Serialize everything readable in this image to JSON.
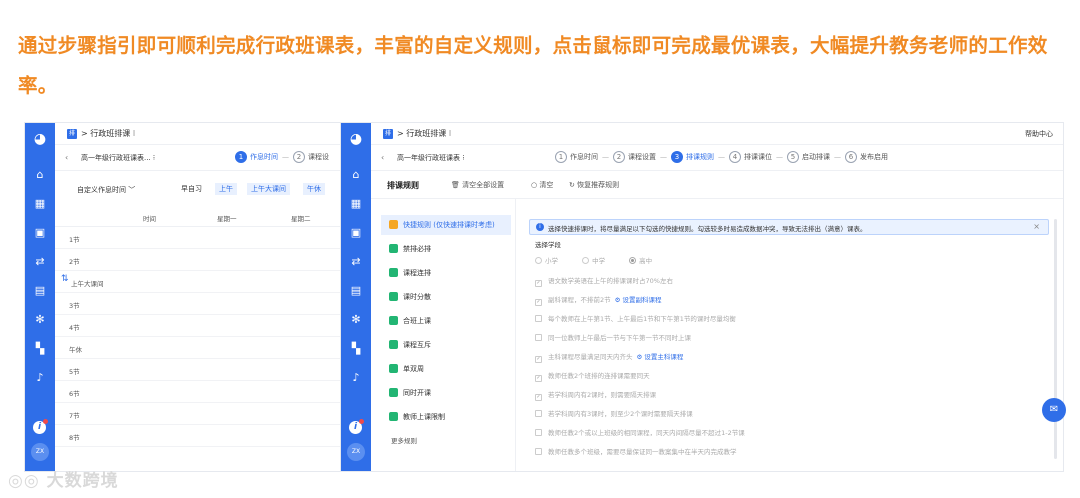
{
  "headline": "通过步骤指引即可顺利完成行政班课表，丰富的自定义规则，点击鼠标即可完成最优课表，大幅提升教务老师的工作效率。",
  "colors": {
    "accent": "#2f6ee8",
    "headline": "#f08a24",
    "rule_icon": "#22b573"
  },
  "sidebar": {
    "icons": [
      "logo-icon",
      "home-icon",
      "schedule-icon",
      "choose-icon",
      "sync-icon",
      "report-icon",
      "settings-icon",
      "apps-icon",
      "bell-icon"
    ],
    "avatar": "ZX",
    "info": "i"
  },
  "left_window": {
    "badge": "排",
    "breadcrumb": "> 行政班排课 ⁝",
    "selector": "高一年级行政班课表...  ⁝",
    "steps": [
      {
        "num": "1",
        "label": "作息时间",
        "active": true
      },
      {
        "num": "2",
        "label": "课程设",
        "active": false
      }
    ],
    "filter_label": "自定义作息时间 ﹀",
    "filters": [
      "早自习",
      "上午",
      "上午大课间",
      "午休"
    ],
    "columns": [
      "时间",
      "星期一",
      "星期二"
    ],
    "rows": [
      "1节",
      "2节",
      "上午大课间",
      "3节",
      "4节",
      "午休",
      "5节",
      "6节",
      "7节",
      "8节"
    ]
  },
  "right_window": {
    "badge": "排",
    "breadcrumb": "> 行政班排课 ⁝",
    "help": "帮助中心",
    "selector": "高一年级行政班课表  ⁝",
    "steps": [
      {
        "num": "1",
        "label": "作息时间",
        "active": false
      },
      {
        "num": "2",
        "label": "课程设置",
        "active": false
      },
      {
        "num": "3",
        "label": "排课规则",
        "active": true
      },
      {
        "num": "4",
        "label": "排课课位",
        "active": false
      },
      {
        "num": "5",
        "label": "启动排课",
        "active": false
      },
      {
        "num": "6",
        "label": "发布启用",
        "active": false
      }
    ],
    "panel_title": "排课规则",
    "clear_all": "清空全部设置",
    "clear": "清空",
    "restore": "恢复推荐规则",
    "rules": [
      "快捷规则 (仅快速排课时考虑)",
      "禁排必排",
      "课程连排",
      "课时分散",
      "合班上课",
      "课程互斥",
      "单双周",
      "同时开课",
      "教师上课限制"
    ],
    "more_rules": "更多规则",
    "notice": "选择快速排课时，将尽量满足以下勾选的快捷规则。勾选较多时易造成数据冲突，导致无法排出（满意）课表。",
    "notice_close": "×",
    "school_label": "选择学段",
    "school_options": [
      "小学",
      "中学",
      "高中"
    ],
    "options": [
      {
        "text": "语文数学英语在上午的排课课时占70%左右",
        "checked": true,
        "link": ""
      },
      {
        "text": "副科课程，不排前2节",
        "checked": true,
        "link": "设置副科课程"
      },
      {
        "text": "每个教师在上午第1节、上午最后1节和下午第1节的课时尽量均衡",
        "checked": false,
        "link": ""
      },
      {
        "text": "同一位教师上午最后一节与下午第一节不同时上课",
        "checked": false,
        "link": ""
      },
      {
        "text": "主科课程尽量满足同天内齐头",
        "checked": true,
        "link": "设置主科课程"
      },
      {
        "text": "教师任教2个班排的连排课需要同天",
        "checked": true,
        "link": ""
      },
      {
        "text": "若学科周内有2课时，则需要隔天排课",
        "checked": true,
        "link": ""
      },
      {
        "text": "若学科周内有3课时，则至少2个课时需要隔天排课",
        "checked": false,
        "link": ""
      },
      {
        "text": "教师任教2个或以上班级的相同课程，同天内间隔尽量不超过1-2节课",
        "checked": false,
        "link": ""
      },
      {
        "text": "教师任教多个班级，需要尽量保证同一教案集中在半天内完成教学",
        "checked": false,
        "link": ""
      }
    ]
  },
  "chat_icon": "chat-icon",
  "watermark": "大数跨境"
}
